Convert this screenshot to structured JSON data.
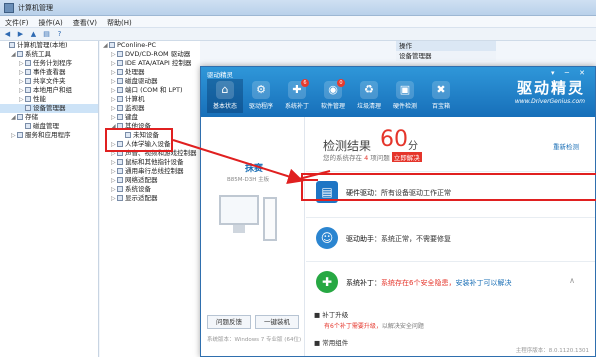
{
  "cm": {
    "title": "计算机管理",
    "menu": [
      "文件(F)",
      "操作(A)",
      "查看(V)",
      "帮助(H)"
    ],
    "toolbar_icons": [
      "back-icon",
      "forward-icon",
      "up-icon",
      "properties-icon",
      "help-icon"
    ],
    "left_tree": [
      {
        "label": "计算机管理(本地)",
        "toggle": "",
        "level": 0,
        "icon": "computer-management-icon"
      },
      {
        "label": "系统工具",
        "toggle": "◢",
        "level": 1,
        "icon": "tools-icon"
      },
      {
        "label": "任务计划程序",
        "toggle": "▷",
        "level": 2,
        "icon": "task-scheduler-icon"
      },
      {
        "label": "事件查看器",
        "toggle": "▷",
        "level": 2,
        "icon": "event-viewer-icon"
      },
      {
        "label": "共享文件夹",
        "toggle": "▷",
        "level": 2,
        "icon": "shared-folder-icon"
      },
      {
        "label": "本地用户和组",
        "toggle": "▷",
        "level": 2,
        "icon": "users-icon"
      },
      {
        "label": "性能",
        "toggle": "▷",
        "level": 2,
        "icon": "performance-icon"
      },
      {
        "label": "设备管理器",
        "toggle": "",
        "level": 2,
        "icon": "device-manager-icon",
        "selected": true
      },
      {
        "label": "存储",
        "toggle": "◢",
        "level": 1,
        "icon": "storage-icon"
      },
      {
        "label": "磁盘管理",
        "toggle": "",
        "level": 2,
        "icon": "disk-icon"
      },
      {
        "label": "服务和应用程序",
        "toggle": "▷",
        "level": 1,
        "icon": "services-icon"
      }
    ],
    "device_tree": [
      {
        "label": "PConline-PC",
        "toggle": "◢",
        "level": 0,
        "icon": "computer-icon"
      },
      {
        "label": "DVD/CD-ROM 驱动器",
        "toggle": "▷",
        "level": 1,
        "icon": "dvd-icon"
      },
      {
        "label": "IDE ATA/ATAPI 控制器",
        "toggle": "▷",
        "level": 1,
        "icon": "ide-icon"
      },
      {
        "label": "处理器",
        "toggle": "▷",
        "level": 1,
        "icon": "cpu-icon"
      },
      {
        "label": "磁盘驱动器",
        "toggle": "▷",
        "level": 1,
        "icon": "disk-drive-icon"
      },
      {
        "label": "端口 (COM 和 LPT)",
        "toggle": "▷",
        "level": 1,
        "icon": "port-icon"
      },
      {
        "label": "计算机",
        "toggle": "▷",
        "level": 1,
        "icon": "computer-icon"
      },
      {
        "label": "监视器",
        "toggle": "▷",
        "level": 1,
        "icon": "monitor-icon"
      },
      {
        "label": "键盘",
        "toggle": "▷",
        "level": 1,
        "icon": "keyboard-icon"
      },
      {
        "label": "其他设备",
        "toggle": "◢",
        "level": 1,
        "icon": "other-devices-icon"
      },
      {
        "label": "未知设备",
        "toggle": "",
        "level": 2,
        "icon": "unknown-device-icon"
      },
      {
        "label": "人体学输入设备",
        "toggle": "▷",
        "level": 1,
        "icon": "hid-icon"
      },
      {
        "label": "声音、视频和游戏控制器",
        "toggle": "▷",
        "level": 1,
        "icon": "sound-icon"
      },
      {
        "label": "鼠标和其他指针设备",
        "toggle": "▷",
        "level": 1,
        "icon": "mouse-icon"
      },
      {
        "label": "通用串行总线控制器",
        "toggle": "▷",
        "level": 1,
        "icon": "usb-icon"
      },
      {
        "label": "网络适配器",
        "toggle": "▷",
        "level": 1,
        "icon": "network-icon"
      },
      {
        "label": "系统设备",
        "toggle": "▷",
        "level": 1,
        "icon": "system-device-icon"
      },
      {
        "label": "显示适配器",
        "toggle": "▷",
        "level": 1,
        "icon": "display-icon"
      }
    ],
    "actions": {
      "header": "操作",
      "item": "设备管理器"
    }
  },
  "dg": {
    "title": "驱动精灵",
    "window_buttons": "▾ ─ ✕",
    "nav": [
      {
        "label": "基本状态",
        "icon": "home-icon",
        "glyph": "⌂",
        "active": true,
        "badge": ""
      },
      {
        "label": "驱动程序",
        "icon": "gear-icon",
        "glyph": "⚙",
        "active": false,
        "badge": ""
      },
      {
        "label": "系统补丁",
        "icon": "shield-icon",
        "glyph": "✚",
        "active": false,
        "badge": "6"
      },
      {
        "label": "软件管理",
        "icon": "disc-icon",
        "glyph": "◉",
        "active": false,
        "badge": "0"
      },
      {
        "label": "垃圾清理",
        "icon": "trash-icon",
        "glyph": "♻",
        "active": false,
        "badge": ""
      },
      {
        "label": "硬件检测",
        "icon": "hardware-icon",
        "glyph": "▣",
        "active": false,
        "badge": ""
      },
      {
        "label": "百宝箱",
        "icon": "toolbox-icon",
        "glyph": "✖",
        "active": false,
        "badge": ""
      }
    ],
    "logo": {
      "text": "驱动精灵",
      "sub": "www.DriverGenius.com"
    },
    "pc": {
      "name": "抹赛",
      "board": "B85M-D3H 主板"
    },
    "buttons": {
      "feedback": "问题反馈",
      "one_click": "一键装机"
    },
    "sys_line": "系统版本：Windows 7 专业版 (64位)",
    "score": {
      "title": "检测结果",
      "value": "60",
      "unit": "分",
      "desc_pre": "您的系统存在 ",
      "desc_num": "4",
      "desc_post": " 项问题",
      "fix": "立即解决"
    },
    "rescan": "重新检测",
    "rows": {
      "hw_label": "硬件驱动：",
      "hw_status": "所有设备驱动工作正常",
      "assist_label": "驱动助手：",
      "assist_status": "系统正常，不需要修复",
      "patch_label": "系统补丁：",
      "patch_warn": "系统存在6个安全隐患，",
      "patch_link": "安装补丁可以解决"
    },
    "sub1": "补丁升级",
    "sub1_desc_pre": "有6个补丁需要升级，",
    "sub1_desc_post": "以解决安全问题",
    "sub2": "常用组件",
    "version": "主程序版本：8.0.1120.1301"
  },
  "colors": {
    "accent": "#1a6fb6",
    "warn": "#e5352b",
    "ok": "#27a843"
  }
}
